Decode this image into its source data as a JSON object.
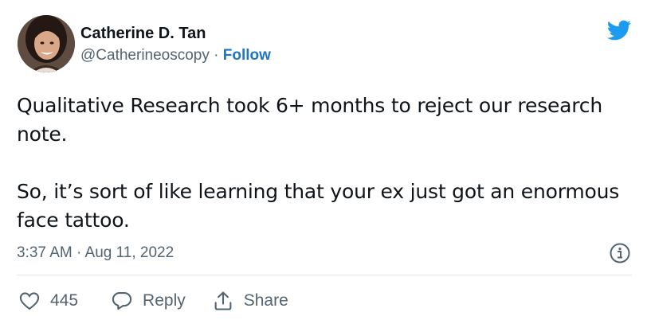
{
  "author": {
    "name": "Catherine D. Tan",
    "handle": "@Catherineoscopy",
    "separator": "·",
    "follow_label": "Follow"
  },
  "tweet": {
    "paragraphs": [
      "Qualitative Research took 6+ months to reject our research note.",
      "So, it’s sort of like learning that your ex just got an enormous face tattoo."
    ],
    "timestamp": "3:37 AM · Aug 11, 2022"
  },
  "actions": {
    "like_count": "445",
    "reply_label": "Reply",
    "share_label": "Share"
  },
  "icons": {
    "brand": "twitter-bird-icon",
    "info": "info-icon",
    "like": "heart-icon",
    "reply": "speech-bubble-icon",
    "share": "share-upload-icon"
  },
  "colors": {
    "twitter_blue": "#1d9bf0",
    "follow_blue": "#1d75c5",
    "text_primary": "#0f1419",
    "text_secondary": "#536471",
    "divider": "#dfe5e8"
  }
}
